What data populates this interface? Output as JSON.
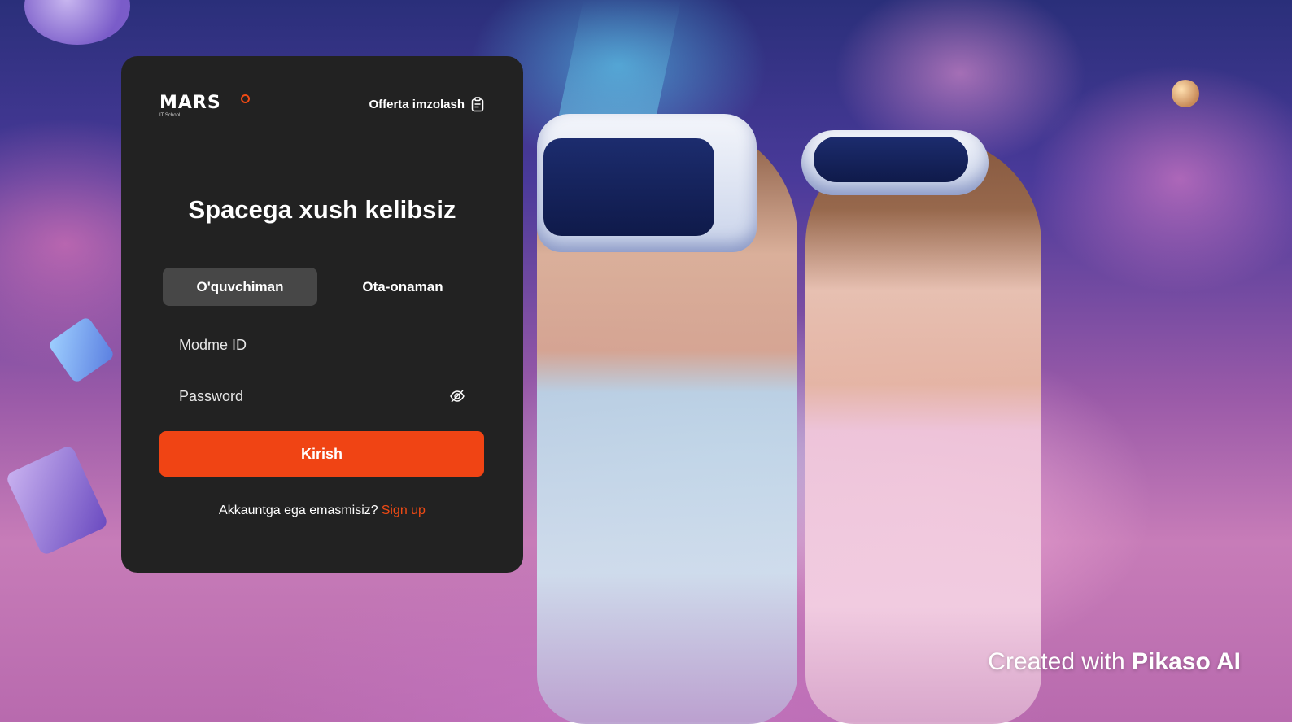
{
  "brand": {
    "logo_text": "MARS",
    "logo_subtext": "IT School",
    "accent_color": "#f04414"
  },
  "header": {
    "offer_link_label": "Offerta imzolash",
    "offer_icon": "clipboard-icon"
  },
  "login": {
    "title": "Spacega xush kelibsiz",
    "tabs": [
      {
        "label": "O'quvchiman",
        "active": true
      },
      {
        "label": "Ota-onaman",
        "active": false
      }
    ],
    "id_field": {
      "placeholder": "Modme ID",
      "value": ""
    },
    "password_field": {
      "placeholder": "Password",
      "value": "",
      "toggle_icon": "eye-off-icon"
    },
    "submit_label": "Kirish",
    "signup_prompt": "Akkauntga ega emasmisiz?",
    "signup_link": "Sign up"
  },
  "watermark": {
    "prefix": "Created with",
    "brand": "Pikaso AI"
  }
}
